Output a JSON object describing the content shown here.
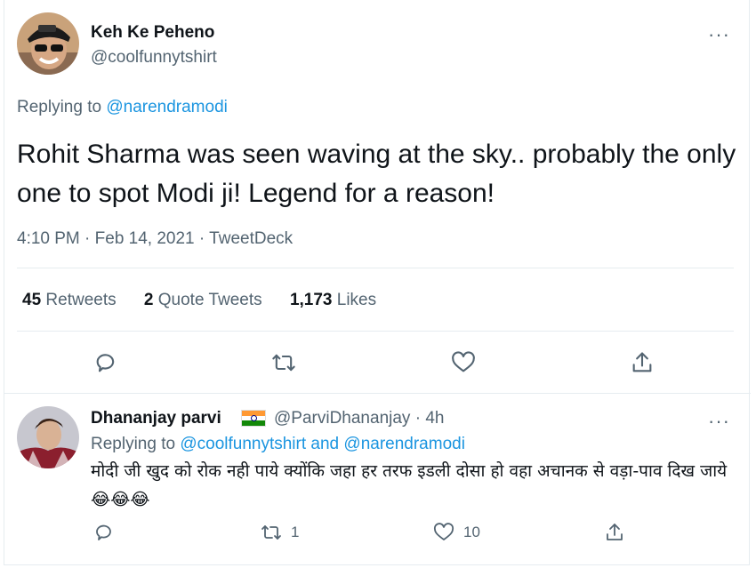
{
  "main_tweet": {
    "author_name": "Keh Ke Peheno",
    "author_handle": "@coolfunnytshirt",
    "replying_prefix": "Replying to ",
    "replying_to": "@narendramodi",
    "text": "Rohit Sharma was seen waving at the sky.. probably the only one to spot Modi ji! Legend for a reason!",
    "timestamp": "4:10 PM · Feb 14, 2021 · ",
    "source": "TweetDeck",
    "stats": {
      "retweets_count": "45",
      "retweets_label": "Retweets",
      "quotes_count": "2",
      "quotes_label": "Quote Tweets",
      "likes_count": "1,173",
      "likes_label": "Likes"
    },
    "more_label": "···"
  },
  "reply": {
    "author_name": "Dhananjay parvi",
    "author_handle": "@ParviDhananjay",
    "separator": "·",
    "time": "4h",
    "replying_prefix": "Replying to ",
    "replying_to_1": "@coolfunnytshirt",
    "replying_and": " and ",
    "replying_to_2": "@narendramodi",
    "text": "मोदी जी खुद को रोक नही पाये क्योंकि जहा हर तरफ इडली दोसा हो वहा अचानक से वड़ा-पाव दिख जाये😂😂😂",
    "retweet_count": "1",
    "like_count": "10",
    "more_label": "···"
  },
  "colors": {
    "link": "#1b95e0",
    "muted": "#536471",
    "text": "#0f1419",
    "divider": "#e6ecf0"
  },
  "icons": [
    "reply-icon",
    "retweet-icon",
    "like-icon",
    "share-icon",
    "more-icon",
    "india-flag-icon"
  ]
}
